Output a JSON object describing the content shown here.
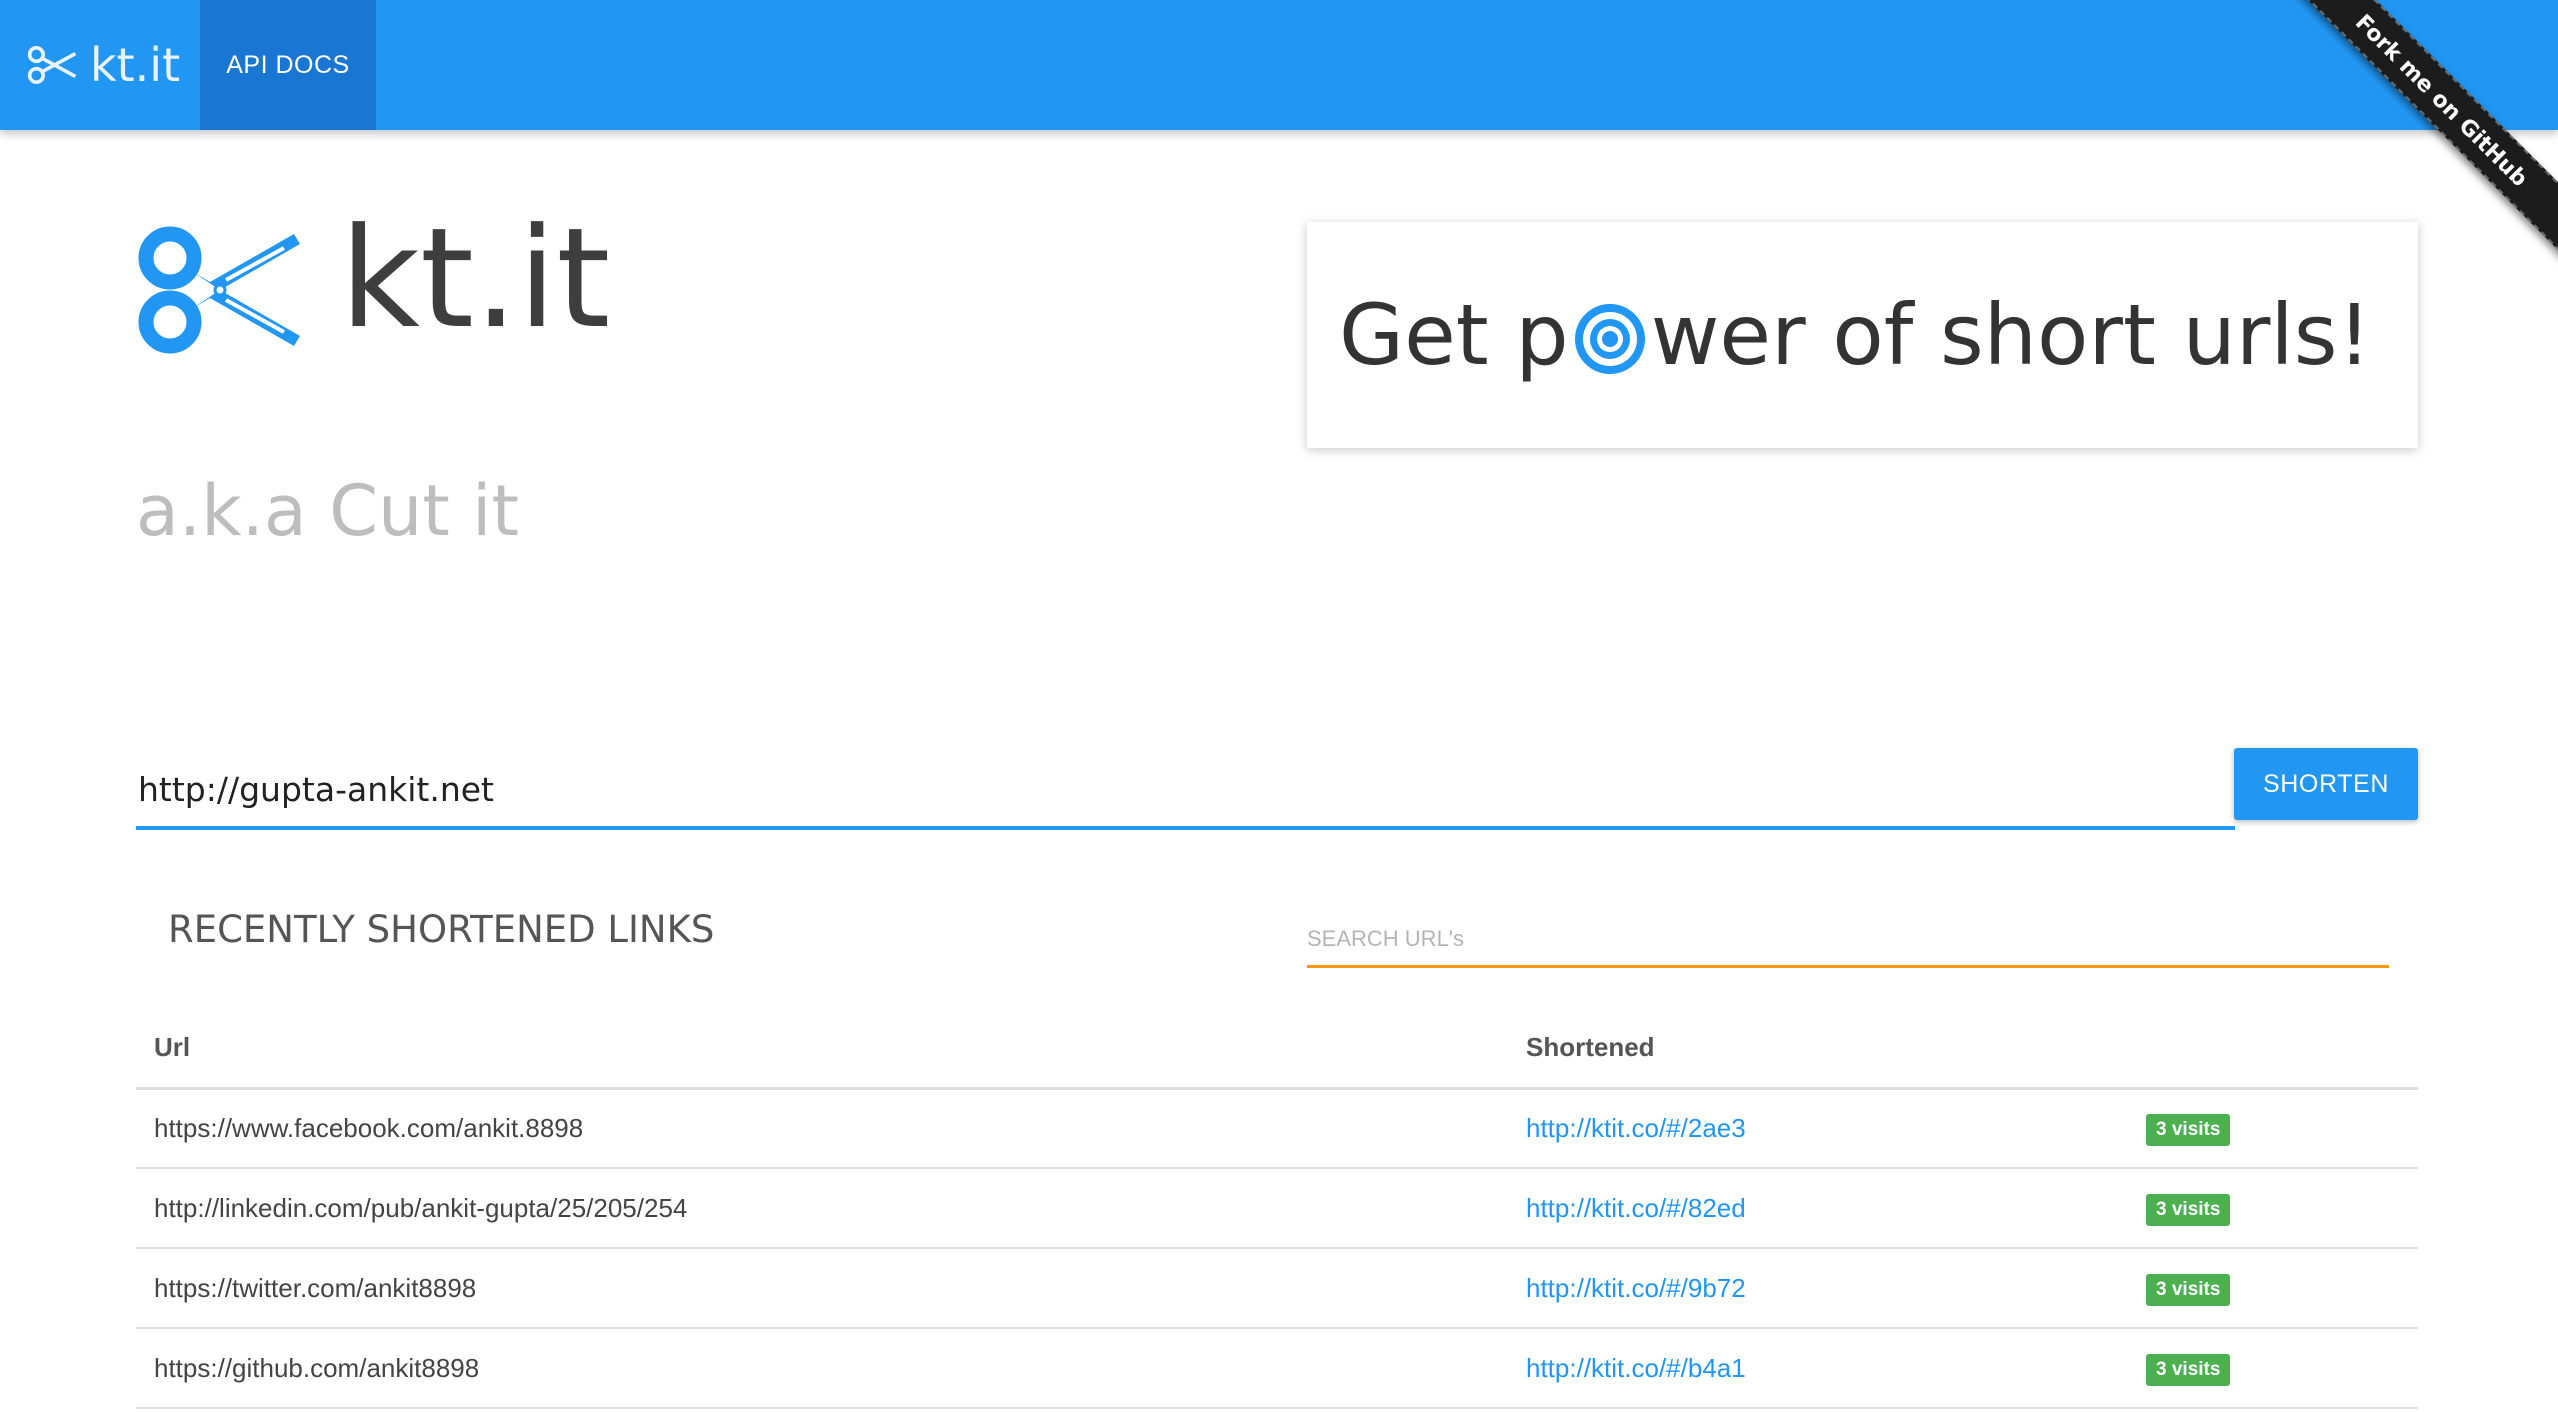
{
  "navbar": {
    "brand": "kt.it",
    "brand_icon": "scissors-icon",
    "api_docs_label": "API DOCS",
    "color": "#2196f3",
    "active_color": "#1976d2"
  },
  "ribbon": {
    "label": "Fork me on GitHub"
  },
  "hero": {
    "logo_text": "kt.it",
    "logo_icon": "scissors-icon",
    "tagline": "a.k.a Cut it",
    "promo_before": "Get p",
    "promo_icon": "target-icon",
    "promo_after": "wer of short urls!"
  },
  "shortener": {
    "url_value": "http://gupta-ankit.net",
    "button_label": "SHORTEN"
  },
  "recent": {
    "title": "RECENTLY SHORTENED LINKS",
    "search_placeholder": "SEARCH URL's",
    "columns": [
      "Url",
      "Shortened",
      ""
    ],
    "rows": [
      {
        "url": "https://www.facebook.com/ankit.8898",
        "short": "http://ktit.co/#/2ae3",
        "visits": "3 visits"
      },
      {
        "url": "http://linkedin.com/pub/ankit-gupta/25/205/254",
        "short": "http://ktit.co/#/82ed",
        "visits": "3 visits"
      },
      {
        "url": "https://twitter.com/ankit8898",
        "short": "http://ktit.co/#/9b72",
        "visits": "3 visits"
      },
      {
        "url": "https://github.com/ankit8898",
        "short": "http://ktit.co/#/b4a1",
        "visits": "3 visits"
      }
    ]
  },
  "colors": {
    "accent": "#2196f3",
    "search_underline": "#ff9800",
    "badge": "#4caf50",
    "ribbon": "#1c1c1c"
  }
}
